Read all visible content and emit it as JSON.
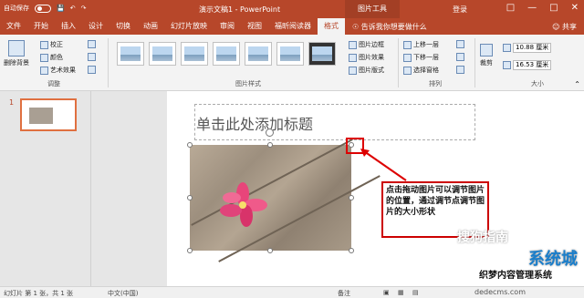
{
  "titlebar": {
    "autosave": "自动保存",
    "toggle": "关",
    "doc_title": "演示文稿1 - PowerPoint",
    "context_tool": "图片工具",
    "login": "登录"
  },
  "tabs": [
    "文件",
    "开始",
    "插入",
    "设计",
    "切换",
    "动画",
    "幻灯片放映",
    "审阅",
    "视图",
    "福昕阅读器",
    "格式"
  ],
  "tell_me": "告诉我你想要做什么",
  "share": "共享",
  "ribbon": {
    "remove_bg": "删除背景",
    "correct": "校正",
    "color": "颜色",
    "art_effects": "艺术效果",
    "adjust_label": "调整",
    "styles_label": "图片样式",
    "border": "图片边框",
    "effects": "图片效果",
    "layout": "图片版式",
    "bring_forward": "上移一层",
    "send_backward": "下移一层",
    "selection_pane": "选择窗格",
    "arrange_label": "排列",
    "crop": "裁剪",
    "height": "10.88 厘米",
    "width": "16.53 厘米",
    "size_label": "大小"
  },
  "slide_pane": {
    "number": "1"
  },
  "slide": {
    "title_placeholder": "单击此处添加标题",
    "callout": "点击拖动图片可以调节图片的位置，通过调节点调节图片的大小形状"
  },
  "statusbar": {
    "slide_info": "幻灯片 第 1 张，共 1 张",
    "language": "中文(中国)",
    "notes": "备注"
  },
  "watermarks": {
    "wm1": "搜狗指南",
    "wm2": "系统城",
    "wm3": "织梦内容管理系统",
    "wm4": "dedecms.com"
  }
}
